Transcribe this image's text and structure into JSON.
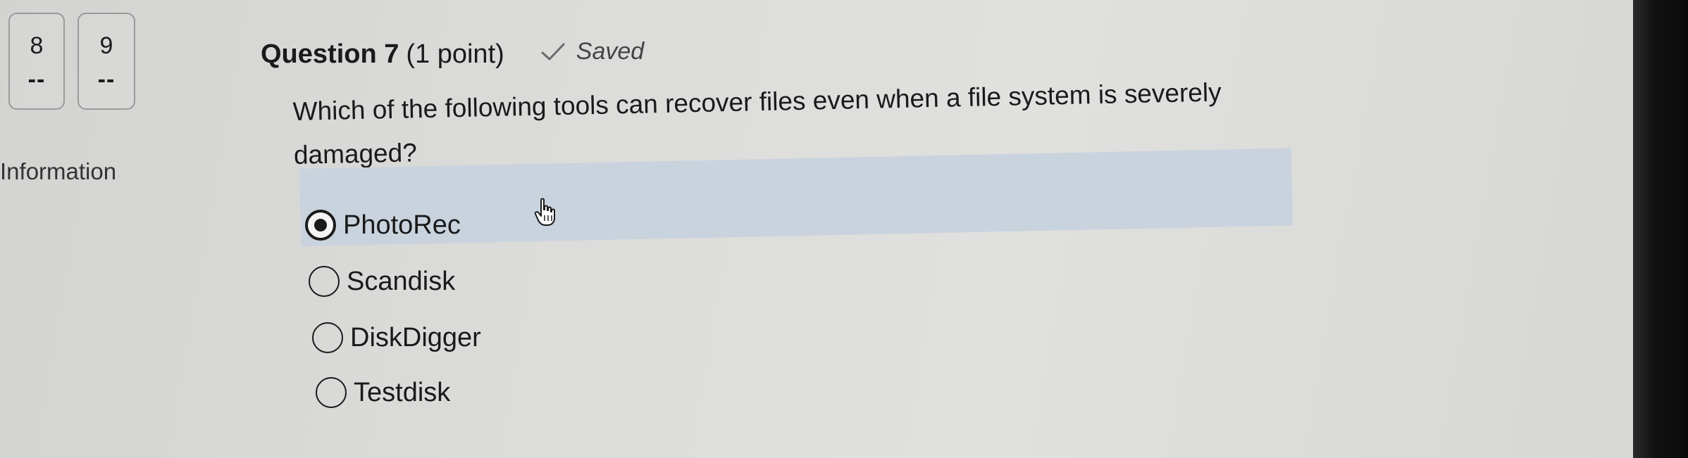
{
  "nav": {
    "items": [
      {
        "number": "8",
        "status": "--"
      },
      {
        "number": "9",
        "status": "--"
      }
    ],
    "section_label": "Information"
  },
  "question": {
    "title": "Question 7",
    "points": "(1 point)",
    "save_status": "Saved",
    "text": "Which of the following tools can recover files even when a file system is severely damaged?"
  },
  "options": [
    {
      "label": "PhotoRec",
      "selected": true
    },
    {
      "label": "Scandisk",
      "selected": false
    },
    {
      "label": "DiskDigger",
      "selected": false
    },
    {
      "label": "Testdisk",
      "selected": false
    }
  ],
  "icons": {
    "saved": "check-icon",
    "pointer": "hand-pointer-icon"
  },
  "colors": {
    "highlight": "#c9d3de",
    "text": "#1a1a1a",
    "saved_text": "#444444"
  }
}
